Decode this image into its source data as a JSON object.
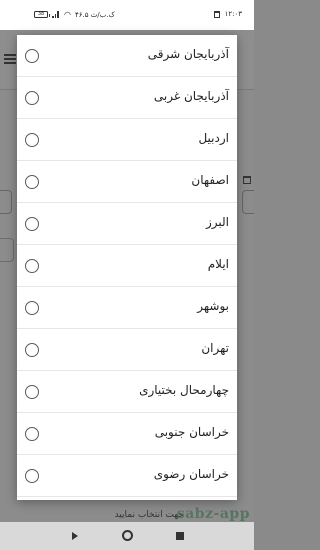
{
  "status_bar": {
    "battery": "38",
    "speed": "۴۶.۵ ک.ب/ث",
    "time": "۱۲:۰۳"
  },
  "background": {
    "hint_text": "جهت انتخاب نمایید",
    "watermark": "sabz-app"
  },
  "dialog": {
    "options": [
      {
        "label": "آذربایجان شرقی"
      },
      {
        "label": "آذربایجان غربی"
      },
      {
        "label": "اردبیل"
      },
      {
        "label": "اصفهان"
      },
      {
        "label": "البرز"
      },
      {
        "label": "ایلام"
      },
      {
        "label": "بوشهر"
      },
      {
        "label": "تهران"
      },
      {
        "label": "چهارمحال بختیاری"
      },
      {
        "label": "خراسان جنوبی"
      },
      {
        "label": "خراسان رضوی"
      }
    ]
  },
  "icons": {
    "back": "back-triangle-icon",
    "home": "home-circle-icon",
    "recent": "recent-square-icon"
  }
}
